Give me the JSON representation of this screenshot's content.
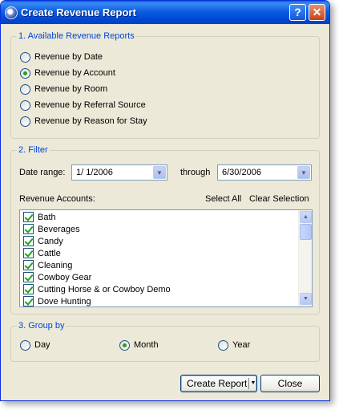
{
  "window": {
    "title": "Create Revenue Report",
    "help_label": "?",
    "close_label": "✕"
  },
  "reports": {
    "legend": "1. Available Revenue Reports",
    "options": [
      {
        "label": "Revenue by Date",
        "checked": false
      },
      {
        "label": "Revenue by Account",
        "checked": true
      },
      {
        "label": "Revenue by Room",
        "checked": false
      },
      {
        "label": "Revenue by Referral Source",
        "checked": false
      },
      {
        "label": "Revenue by Reason for Stay",
        "checked": false
      }
    ]
  },
  "filter": {
    "legend": "2. Filter",
    "date_range_label": "Date range:",
    "start_date": "1/  1/2006",
    "through_label": "through",
    "end_date": "6/30/2006",
    "accounts_label": "Revenue Accounts:",
    "select_all": "Select All",
    "clear_selection": "Clear Selection",
    "accounts": [
      {
        "label": "Bath",
        "checked": true
      },
      {
        "label": "Beverages",
        "checked": true
      },
      {
        "label": "Candy",
        "checked": true
      },
      {
        "label": "Cattle",
        "checked": true
      },
      {
        "label": "Cleaning",
        "checked": true
      },
      {
        "label": "Cowboy Gear",
        "checked": true
      },
      {
        "label": "Cutting Horse & or Cowboy Demo",
        "checked": true
      },
      {
        "label": "Dove Hunting",
        "checked": true
      }
    ]
  },
  "group_by": {
    "legend": "3. Group by",
    "options": [
      {
        "label": "Day",
        "checked": false
      },
      {
        "label": "Month",
        "checked": true
      },
      {
        "label": "Year",
        "checked": false
      }
    ]
  },
  "footer": {
    "create_label": "Create Report",
    "close_label": "Close"
  },
  "icons": {
    "dropdown": "▼",
    "scroll_up": "▲",
    "scroll_down": "▼",
    "split_arrow": "▼"
  },
  "colors": {
    "accent": "#0046d5",
    "check": "#21a121",
    "titlebar": "#0047d4"
  }
}
